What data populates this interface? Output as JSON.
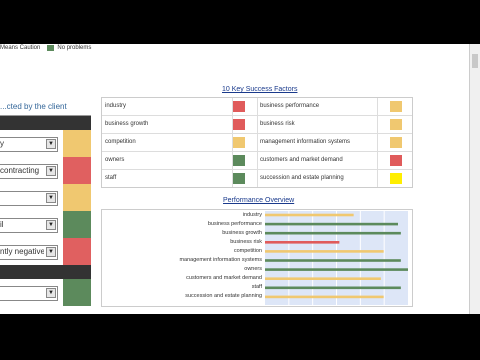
{
  "legend": {
    "text1": "Means Caution",
    "text2": "No problems",
    "colors": {
      "caution": "#e6c566",
      "ok": "#5c8a5c"
    }
  },
  "left_panel": {
    "title": "...cted by the client",
    "rows": [
      {
        "type": "header"
      },
      {
        "type": "select",
        "value": "y",
        "status": "#f0c870"
      },
      {
        "type": "select",
        "value": "contracting",
        "status": "#e06060"
      },
      {
        "type": "select",
        "value": "",
        "status": "#f0c870"
      },
      {
        "type": "select",
        "value": "il",
        "status": "#5c8a5c"
      },
      {
        "type": "select",
        "value": "ntly negative",
        "status": "#e06060"
      },
      {
        "type": "header"
      },
      {
        "type": "select",
        "value": "",
        "status": "#5c8a5c"
      }
    ]
  },
  "ksf": {
    "title": "10 Key Success Factors",
    "rows": [
      {
        "left": "industry",
        "left_color": "#e05b5b",
        "right": "business performance",
        "right_color": "#f0c870"
      },
      {
        "left": "business growth",
        "left_color": "#e05b5b",
        "right": "business risk",
        "right_color": "#f0c870"
      },
      {
        "left": "competition",
        "left_color": "#f0c870",
        "right": "management information systems",
        "right_color": "#f0c870"
      },
      {
        "left": "owners",
        "left_color": "#5c8a5c",
        "right": "customers and market demand",
        "right_color": "#e05b5b"
      },
      {
        "left": "staff",
        "left_color": "#5c8a5c",
        "right": "succession and estate planning",
        "right_color": "#ffee00"
      }
    ]
  },
  "performance": {
    "title": "Performance Overview",
    "items": [
      {
        "label": "industry",
        "fill": 0.62,
        "color": "#f0c870"
      },
      {
        "label": "business performance",
        "fill": 0.93,
        "color": "#5c8a5c"
      },
      {
        "label": "business growth",
        "fill": 0.95,
        "color": "#5c8a5c"
      },
      {
        "label": "business risk",
        "fill": 0.52,
        "color": "#e05b5b"
      },
      {
        "label": "competition",
        "fill": 0.83,
        "color": "#f0c870"
      },
      {
        "label": "management information systems",
        "fill": 0.95,
        "color": "#5c8a5c"
      },
      {
        "label": "owners",
        "fill": 1.0,
        "color": "#5c8a5c"
      },
      {
        "label": "customers and market demand",
        "fill": 0.81,
        "color": "#f0c870"
      },
      {
        "label": "staff",
        "fill": 0.95,
        "color": "#5c8a5c"
      },
      {
        "label": "succession and estate planning",
        "fill": 0.83,
        "color": "#f0c870"
      }
    ]
  }
}
